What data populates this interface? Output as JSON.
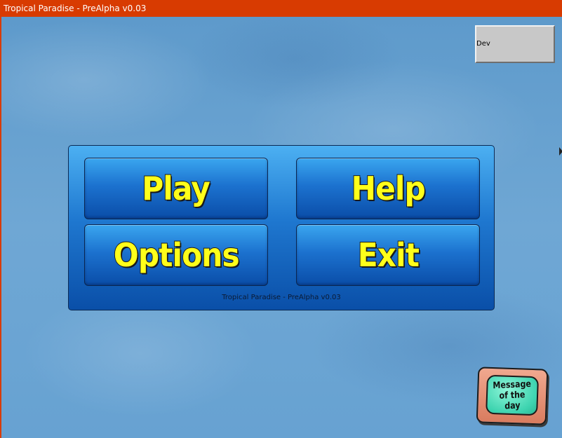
{
  "window": {
    "title": "Tropical Paradise - PreAlpha v0.03",
    "titlebar_color": "#d83b01"
  },
  "dev_button": {
    "label": "Dev"
  },
  "menu": {
    "play_label": "Play",
    "help_label": "Help",
    "options_label": "Options",
    "exit_label": "Exit",
    "caption": "Tropical Paradise - PreAlpha v0.03",
    "label_color": "#ffff1a",
    "panel_color": "#1f78d0"
  },
  "motd": {
    "label": "Message\nof the day",
    "screen_color": "#3ed4b0",
    "frame_color": "#d97c5f"
  }
}
